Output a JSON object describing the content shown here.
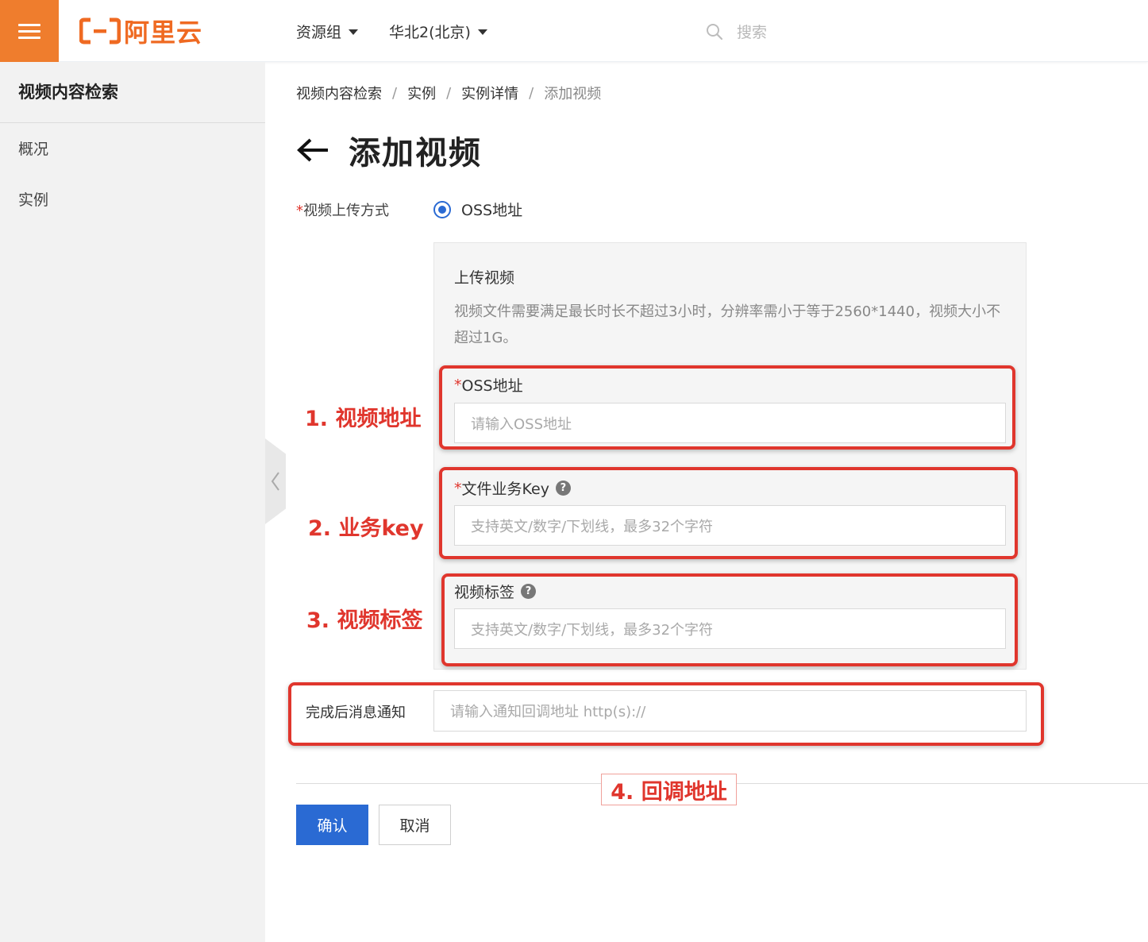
{
  "header": {
    "logo_text": "阿里云",
    "resource_group": "资源组",
    "region": "华北2(北京)",
    "search_placeholder": "搜索"
  },
  "sidebar": {
    "title": "视频内容检索",
    "items": [
      {
        "label": "概况"
      },
      {
        "label": "实例"
      }
    ]
  },
  "breadcrumb": [
    "视频内容检索",
    "实例",
    "实例详情",
    "添加视频"
  ],
  "page": {
    "title": "添加视频"
  },
  "form": {
    "upload_method": {
      "label": "视频上传方式",
      "required_mark": "*",
      "option": "OSS地址"
    },
    "upload_section": {
      "title": "上传视频",
      "description": "视频文件需要满足最长时长不超过3小时，分辨率需小于等于2560*1440，视频大小不超过1G。"
    },
    "oss_address": {
      "label": "OSS地址",
      "required_mark": "*",
      "placeholder": "请输入OSS地址"
    },
    "file_key": {
      "label": "文件业务Key",
      "required_mark": "*",
      "placeholder": "支持英文/数字/下划线，最多32个字符"
    },
    "video_tags": {
      "label": "视频标签",
      "placeholder": "支持英文/数字/下划线，最多32个字符"
    },
    "notify": {
      "label": "完成后消息通知",
      "placeholder": "请输入通知回调地址 http(s)://"
    }
  },
  "annotations": [
    "1. 视频地址",
    "2. 业务key",
    "3. 视频标签",
    "4. 回调地址"
  ],
  "buttons": {
    "confirm": "确认",
    "cancel": "取消"
  },
  "colors": {
    "brand_orange": "#ef7d2d",
    "primary_blue": "#2a6ad3",
    "annotation_red": "#e0362d"
  }
}
